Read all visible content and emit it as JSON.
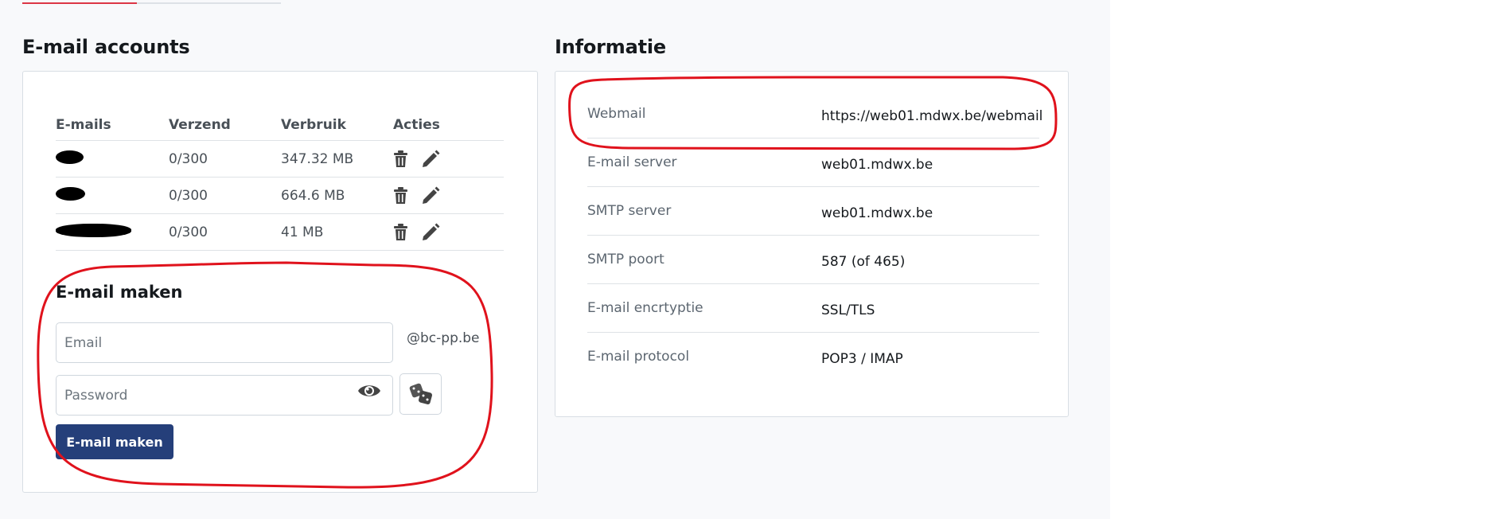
{
  "accounts": {
    "title": "E-mail accounts",
    "table": {
      "headers": [
        "E-mails",
        "Verzend",
        "Verbruik",
        "Acties"
      ],
      "rows": [
        {
          "verzend": "0/300",
          "verbruik": "347.32 MB"
        },
        {
          "verzend": "0/300",
          "verbruik": "664.6 MB"
        },
        {
          "verzend": "0/300",
          "verbruik": "41 MB"
        }
      ]
    },
    "create": {
      "title": "E-mail maken",
      "email_placeholder": "Email",
      "domain_suffix": "@bc-pp.be",
      "password_placeholder": "Password",
      "submit_label": "E-mail maken"
    }
  },
  "info": {
    "title": "Informatie",
    "rows": [
      {
        "label": "Webmail",
        "value": "https://web01.mdwx.be/webmail"
      },
      {
        "label": "E-mail server",
        "value": "web01.mdwx.be"
      },
      {
        "label": "SMTP server",
        "value": "web01.mdwx.be"
      },
      {
        "label": "SMTP poort",
        "value": "587 (of 465)"
      },
      {
        "label": "E-mail encrtyptie",
        "value": "SSL/TLS"
      },
      {
        "label": "E-mail protocol",
        "value": "POP3 / IMAP"
      }
    ]
  },
  "colors": {
    "primary_button": "#253f7a",
    "annotation_red": "#e0121c",
    "tab_active": "#dc3545"
  },
  "icons": {
    "delete": "trash-icon",
    "edit": "pencil-icon",
    "reveal": "eye-icon",
    "generate": "dice-icon"
  }
}
